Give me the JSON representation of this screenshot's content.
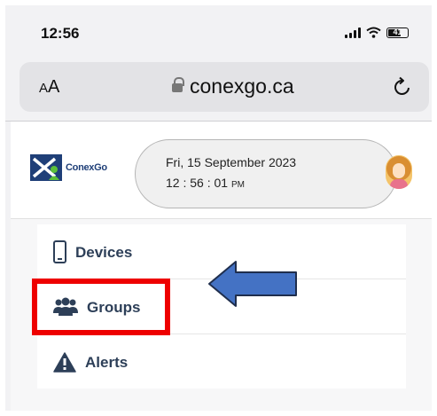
{
  "status_bar": {
    "time": "12:56",
    "battery": "41"
  },
  "browser": {
    "aa_small": "A",
    "aa_large": "A",
    "url": "conexgo.ca"
  },
  "app": {
    "logo_text": "ConexGo",
    "date": "Fri, 15 September 2023",
    "time": "12 : 56 : 01",
    "ampm": "PM"
  },
  "menu": {
    "items": [
      {
        "label": "Devices",
        "icon": "phone-icon"
      },
      {
        "label": "Groups",
        "icon": "users-icon"
      },
      {
        "label": "Alerts",
        "icon": "warning-icon"
      }
    ]
  },
  "annotations": {
    "highlight_color": "#ee0000",
    "arrow_color": "#4472c4"
  }
}
